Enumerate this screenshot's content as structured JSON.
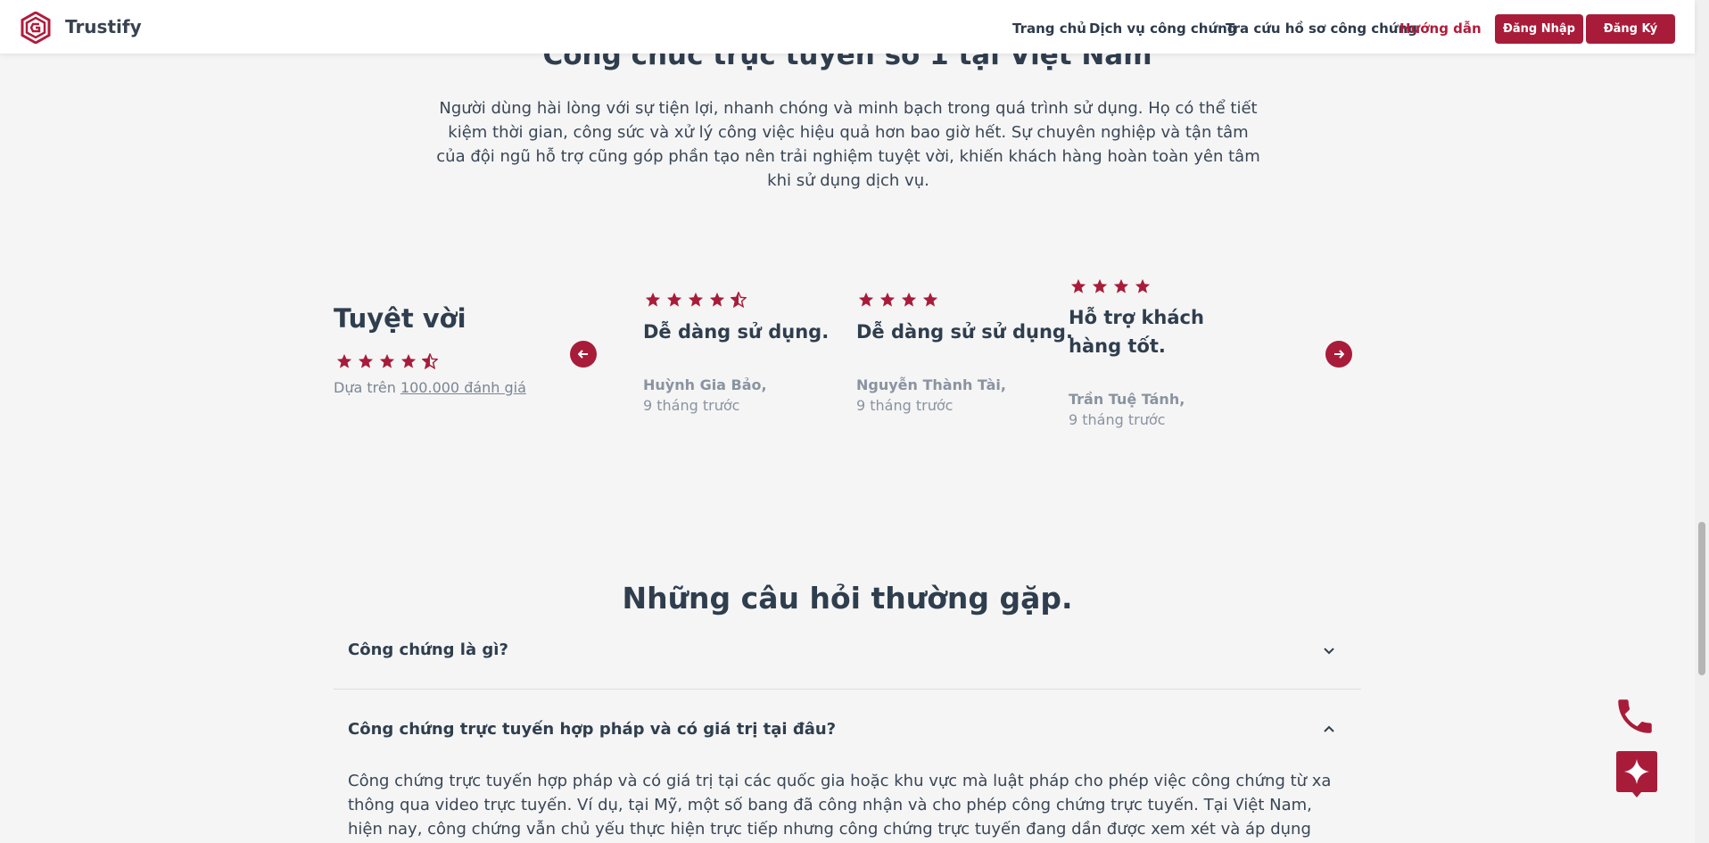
{
  "header": {
    "brand": "Trustify",
    "nav": [
      "Trang chủ",
      "Dịch vụ công chứng",
      "Tra cứu hồ sơ công chứng",
      "Hướng dẫn"
    ],
    "login": "Đăng Nhập",
    "register": "Đăng Ký",
    "accent": "#a81c3a"
  },
  "hero": {
    "title": "Công chức trực tuyến số 1 tại Việt Nam",
    "description": "Người dùng hài lòng với sự tiện lợi, nhanh chóng và minh bạch trong quá trình sử dụng. Họ có thể tiết kiệm thời gian, công sức và xử lý công việc hiệu quả hơn bao giờ hết. Sự chuyên nghiệp và tận tâm của đội ngũ hỗ trợ cũng góp phần tạo nên trải nghiệm tuyệt vời, khiến khách hàng hoàn toàn yên tâm khi sử dụng dịch vụ."
  },
  "rating": {
    "title": "Tuyệt vời",
    "stars": 4.5,
    "based_on": "Dựa trên",
    "count": "100.000 đánh giá"
  },
  "reviews": [
    {
      "title": "Dễ dàng sử dụng.",
      "author": "Huỳnh Gia Bảo,",
      "time": "9 tháng trước",
      "stars": 4.5
    },
    {
      "title": "Dễ dàng sử sử dụng.",
      "author": "Nguyễn Thành Tài,",
      "time": "9 tháng trước",
      "stars": 4
    },
    {
      "title": "Hỗ trợ khách hàng tốt.",
      "author": "Trần Tuệ Tánh,",
      "time": "9 tháng trước",
      "stars": 4
    }
  ],
  "faq": {
    "title": "Những câu hỏi thường gặp.",
    "items": [
      {
        "question": "Công chứng là gì?",
        "expanded": false
      },
      {
        "question": "Công chứng trực tuyến hợp pháp và có giá trị tại đâu?",
        "expanded": true,
        "answer": "Công chứng trực tuyến hợp pháp và có giá trị tại các quốc gia hoặc khu vực mà luật pháp cho phép việc công chứng từ xa thông qua video trực tuyến. Ví dụ, tại Mỹ, một số bang đã công nhận và cho phép công chứng trực tuyến. Tại Việt Nam, hiện nay, công chứng vẫn chủ yếu thực hiện trực tiếp nhưng công chứng trực tuyến đang dần được xem xét và áp dụng theo các quy"
      }
    ]
  }
}
